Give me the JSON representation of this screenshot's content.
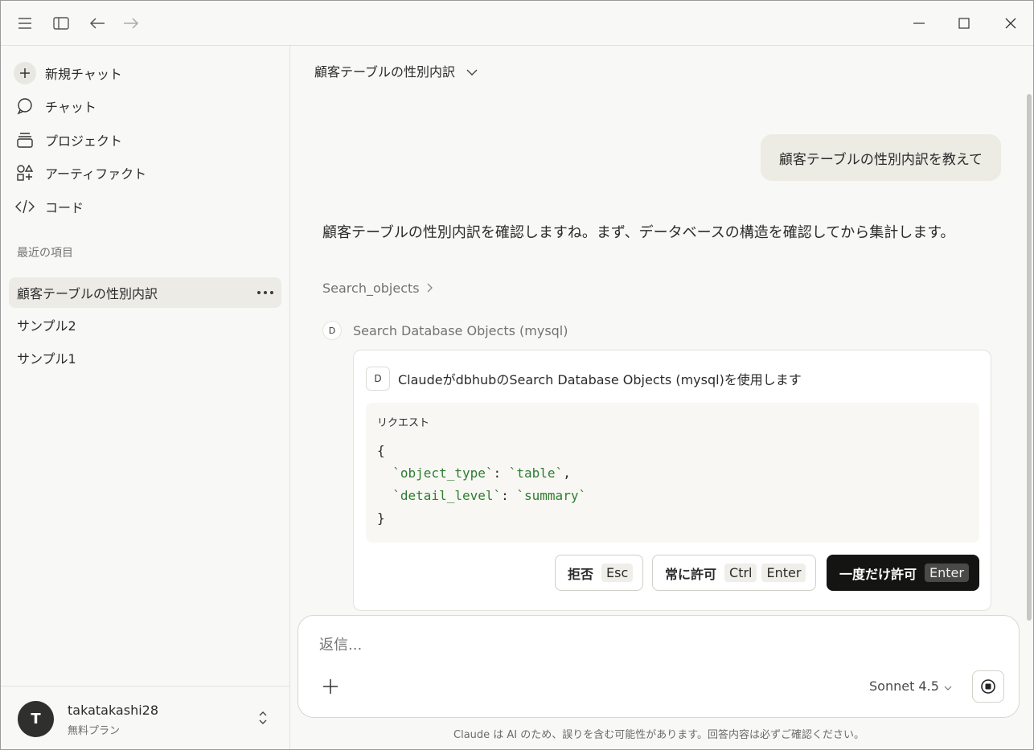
{
  "titlebar": {
    "icons": [
      "menu-icon",
      "sidebar-toggle-icon",
      "back-arrow-icon",
      "forward-arrow-icon",
      "minimize-icon",
      "maximize-icon",
      "close-icon"
    ]
  },
  "sidebar": {
    "nav": {
      "new_chat": "新規チャット",
      "chats": "チャット",
      "projects": "プロジェクト",
      "artifacts": "アーティファクト",
      "code": "コード"
    },
    "recent_label": "最近の項目",
    "recent": [
      "顧客テーブルの性別内訳",
      "サンプル2",
      "サンプル1"
    ],
    "user": {
      "initial": "T",
      "name": "takatakashi28",
      "plan": "無料プラン"
    }
  },
  "main": {
    "title": "顧客テーブルの性別内訳",
    "user_message": "顧客テーブルの性別内訳を教えて",
    "assistant_message": "顧客テーブルの性別内訳を確認しますね。まず、データベースの構造を確認してから集計します。",
    "tool_link": "Search_objects",
    "tool_row": {
      "badge": "D",
      "label": "Search Database Objects (mysql)"
    },
    "permission": {
      "badge": "D",
      "heading": "ClaudeがdbhubのSearch Database Objects (mysql)を使用します",
      "request_label": "リクエスト",
      "code": {
        "open": "{",
        "line1_key": "`object_type`",
        "line1_sep": ": ",
        "line1_val": "`table`",
        "line1_end": ",",
        "line2_key": "`detail_level`",
        "line2_sep": ": ",
        "line2_val": "`summary`",
        "close": "}"
      },
      "buttons": {
        "deny": "拒否",
        "deny_key": "Esc",
        "always": "常に許可",
        "always_key1": "Ctrl",
        "always_key2": "Enter",
        "once": "一度だけ許可",
        "once_key": "Enter"
      }
    },
    "composer": {
      "placeholder": "返信...",
      "model": "Sonnet 4.5"
    },
    "disclaimer": "Claude は AI のため、誤りを含む可能性があります。回答内容は必ずご確認ください。"
  },
  "colors": {
    "background": "#f8f8f6",
    "code_string": "#2e7d32",
    "primary_button": "#141413"
  }
}
